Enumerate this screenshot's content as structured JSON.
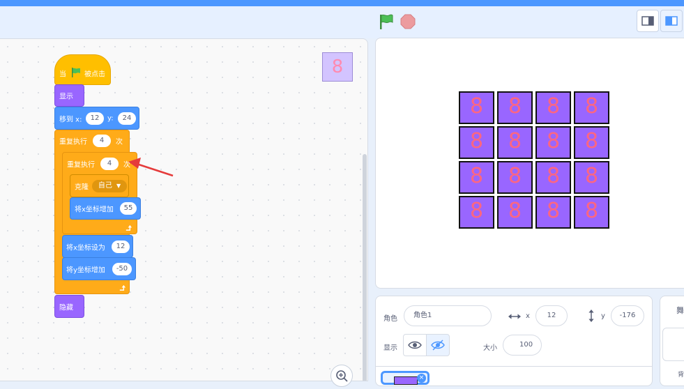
{
  "header": {
    "flag_icon": "green-flag-icon",
    "stop_icon": "stop-icon",
    "flag_color": "#4cbf56",
    "stop_color": "#ec9b9e"
  },
  "code": {
    "sprite_thumb": "8",
    "blocks": {
      "when_prefix": "当",
      "when_suffix": "被点击",
      "show": "显示",
      "goto_label": "移到 x:",
      "goto_x": "12",
      "goto_y_label": "y:",
      "goto_y": "24",
      "repeat_outer_label": "重复执行",
      "repeat_outer_count": "4",
      "repeat_outer_unit": "次",
      "repeat_inner_label": "重复执行",
      "repeat_inner_count": "4",
      "repeat_inner_unit": "次",
      "clone_label": "克隆",
      "clone_target": "自己",
      "change_x_label": "将x坐标增加",
      "change_x_value": "55",
      "set_x_label": "将x坐标设为",
      "set_x_value": "12",
      "change_y_label": "将y坐标增加",
      "change_y_value": "-50",
      "hide": "隐藏"
    }
  },
  "stage": {
    "cell_label": "8",
    "cell_color": "#9966ff",
    "digit_color": "#ff6680"
  },
  "sprite_panel": {
    "sprite_label": "角色",
    "sprite_name": "角色1",
    "x_label": "x",
    "x_value": "12",
    "y_label": "y",
    "y_value": "-176",
    "show_label": "显示",
    "size_label": "大小",
    "size_value": "100"
  },
  "stage_panel": {
    "title": "舞",
    "backdrop_label": "背"
  }
}
